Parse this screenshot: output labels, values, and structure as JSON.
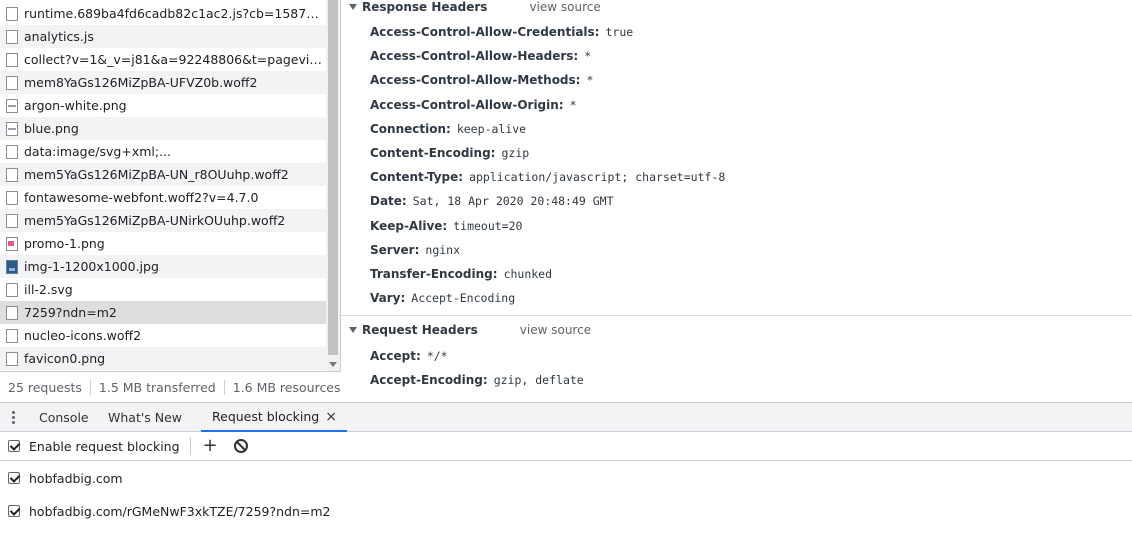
{
  "network": {
    "files": [
      {
        "name": "runtime.689ba4fd6cadb82c1ac2.js?cb=15872429...",
        "icon": "document-icon"
      },
      {
        "name": "analytics.js",
        "icon": "document-icon"
      },
      {
        "name": "collect?v=1&_v=j81&a=92248806&t=pageview&_s...",
        "icon": "document-icon"
      },
      {
        "name": "mem8YaGs126MiZpBA-UFVZ0b.woff2",
        "icon": "document-icon"
      },
      {
        "name": "argon-white.png",
        "icon": "image-icon"
      },
      {
        "name": "blue.png",
        "icon": "image-icon"
      },
      {
        "name": "data:image/svg+xml;...",
        "icon": "document-icon"
      },
      {
        "name": "mem5YaGs126MiZpBA-UN_r8OUuhp.woff2",
        "icon": "document-icon"
      },
      {
        "name": "fontawesome-webfont.woff2?v=4.7.0",
        "icon": "document-icon"
      },
      {
        "name": "mem5YaGs126MiZpBA-UNirkOUuhp.woff2",
        "icon": "document-icon"
      },
      {
        "name": "promo-1.png",
        "icon": "image-icon"
      },
      {
        "name": "img-1-1200x1000.jpg",
        "icon": "photo-icon"
      },
      {
        "name": "ill-2.svg",
        "icon": "document-icon"
      },
      {
        "name": "7259?ndn=m2",
        "icon": "document-icon"
      },
      {
        "name": "nucleo-icons.woff2",
        "icon": "document-icon"
      },
      {
        "name": "favicon0.png",
        "icon": "document-icon"
      }
    ],
    "selected_file": "7259?ndn=m2",
    "status": {
      "requests": "25 requests",
      "transferred": "1.5 MB transferred",
      "resources": "1.6 MB resources"
    }
  },
  "headers_panel": {
    "response": {
      "title": "Response Headers",
      "view_source": "view source",
      "rows": [
        {
          "name": "Access-Control-Allow-Credentials:",
          "value": "true"
        },
        {
          "name": "Access-Control-Allow-Headers:",
          "value": "*"
        },
        {
          "name": "Access-Control-Allow-Methods:",
          "value": "*"
        },
        {
          "name": "Access-Control-Allow-Origin:",
          "value": "*"
        },
        {
          "name": "Connection:",
          "value": "keep-alive"
        },
        {
          "name": "Content-Encoding:",
          "value": "gzip"
        },
        {
          "name": "Content-Type:",
          "value": "application/javascript; charset=utf-8"
        },
        {
          "name": "Date:",
          "value": "Sat, 18 Apr 2020 20:48:49 GMT"
        },
        {
          "name": "Keep-Alive:",
          "value": "timeout=20"
        },
        {
          "name": "Server:",
          "value": "nginx"
        },
        {
          "name": "Transfer-Encoding:",
          "value": "chunked"
        },
        {
          "name": "Vary:",
          "value": "Accept-Encoding"
        }
      ]
    },
    "request": {
      "title": "Request Headers",
      "view_source": "view source",
      "rows": [
        {
          "name": "Accept:",
          "value": "*/*"
        },
        {
          "name": "Accept-Encoding:",
          "value": "gzip, deflate"
        }
      ]
    }
  },
  "drawer": {
    "tabs": [
      {
        "label": "Console"
      },
      {
        "label": "What's New"
      },
      {
        "label": "Request blocking",
        "active": true
      }
    ],
    "close_glyph": "×",
    "enable_label": "Enable request blocking",
    "enable_checked": true,
    "add_glyph": "+",
    "patterns": [
      {
        "text": "hobfadbig.com",
        "checked": true
      },
      {
        "text": "hobfadbig.com/rGMeNwF3xkTZE/7259?ndn=m2",
        "checked": true
      }
    ]
  },
  "colors": {
    "accent": "#1a73e8",
    "selected_row": "#dedede",
    "stripe": "#f1f3f4"
  }
}
